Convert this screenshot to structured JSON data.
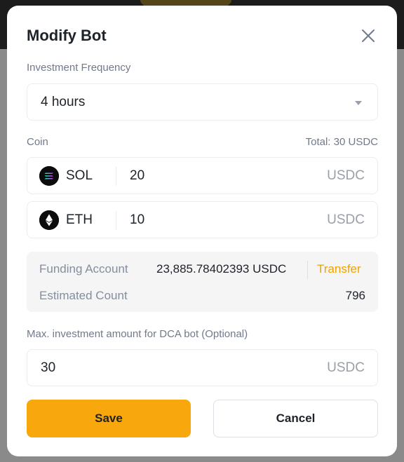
{
  "modal": {
    "title": "Modify Bot"
  },
  "frequency": {
    "label": "Investment Frequency",
    "value": "4 hours"
  },
  "coin_section": {
    "label": "Coin",
    "total": "Total: 30 USDC",
    "coins": [
      {
        "name": "SOL",
        "amount": "20",
        "unit": "USDC",
        "icon": "solana-icon"
      },
      {
        "name": "ETH",
        "amount": "10",
        "unit": "USDC",
        "icon": "ethereum-icon"
      }
    ]
  },
  "funding": {
    "funding_label": "Funding Account",
    "funding_value": "23,885.78402393 USDC",
    "transfer_label": "Transfer",
    "count_label": "Estimated Count",
    "count_value": "796"
  },
  "max_investment": {
    "label": "Max. investment amount for DCA bot (Optional)",
    "value": "30",
    "unit": "USDC"
  },
  "buttons": {
    "save": "Save",
    "cancel": "Cancel"
  },
  "colors": {
    "accent": "#f8a80c",
    "transfer": "#f0a300"
  }
}
